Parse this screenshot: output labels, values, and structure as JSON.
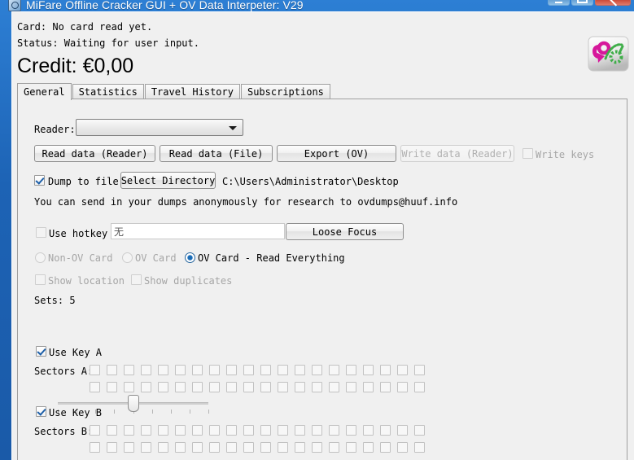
{
  "window": {
    "title": "MiFare Offline Cracker GUI + OV Data Interpeter: V29",
    "icon": "app-icon",
    "controls": {
      "minimize": "minimize-icon",
      "maximize": "maximize-icon",
      "close": "close-icon"
    }
  },
  "header": {
    "card_line": "Card: No card read yet.",
    "status_line": "Status: Waiting for user input.",
    "credit_line": "Credit: €0,00",
    "logo": "ov-chipkaart-logo"
  },
  "tabs": [
    {
      "label": "General",
      "active": true
    },
    {
      "label": "Statistics",
      "active": false
    },
    {
      "label": "Travel History",
      "active": false
    },
    {
      "label": "Subscriptions",
      "active": false
    }
  ],
  "general": {
    "reader_label": "Reader:",
    "reader_value": "",
    "buttons": [
      {
        "label": "Read data (Reader)",
        "disabled": false
      },
      {
        "label": "Read data (File)",
        "disabled": false
      },
      {
        "label": "Export (OV)",
        "disabled": false
      },
      {
        "label": "Write data (Reader)",
        "disabled": true
      }
    ],
    "write_keys": {
      "label": "Write keys",
      "checked": false,
      "disabled": true
    },
    "dump_to_file": {
      "label": "Dump to file",
      "checked": true,
      "disabled": false
    },
    "select_directory_label": "Select Directory",
    "directory_path": "C:\\Users\\Administrator\\Desktop",
    "info_text": "You can send in your dumps anonymously for research to ovdumps@huuf.info",
    "use_hotkey": {
      "label": "Use hotkey",
      "checked": false,
      "disabled": true
    },
    "hotkey_value": "无",
    "loose_focus_label": "Loose Focus",
    "card_mode": [
      {
        "label": "Non-OV Card",
        "selected": false,
        "disabled": true
      },
      {
        "label": "OV Card",
        "selected": false,
        "disabled": true
      },
      {
        "label": "OV Card - Read Everything",
        "selected": true,
        "disabled": false
      }
    ],
    "show_location": {
      "label": "Show location",
      "checked": false,
      "disabled": true
    },
    "show_duplicates": {
      "label": "Show duplicates",
      "checked": false,
      "disabled": true
    },
    "sets": {
      "label": "Sets: 5",
      "value": 5,
      "min": 1,
      "max": 9,
      "ticks": 9
    },
    "use_key_a": {
      "label": "Use Key A",
      "checked": true
    },
    "sectors_a_label": "Sectors A:",
    "sectors_a_row1_count": 20,
    "sectors_a_row2_count": 20,
    "use_key_b": {
      "label": "Use Key B",
      "checked": true
    },
    "sectors_b_label": "Sectors B:",
    "sectors_b_row1_count": 20,
    "sectors_b_row2_count": 20
  },
  "colors": {
    "titlebar": "#1f6fc4",
    "client_bg": "#f0f0f0",
    "accent_check": "#1d5fa8",
    "logo_magenta": "#d6189b",
    "logo_green": "#3fae49"
  }
}
